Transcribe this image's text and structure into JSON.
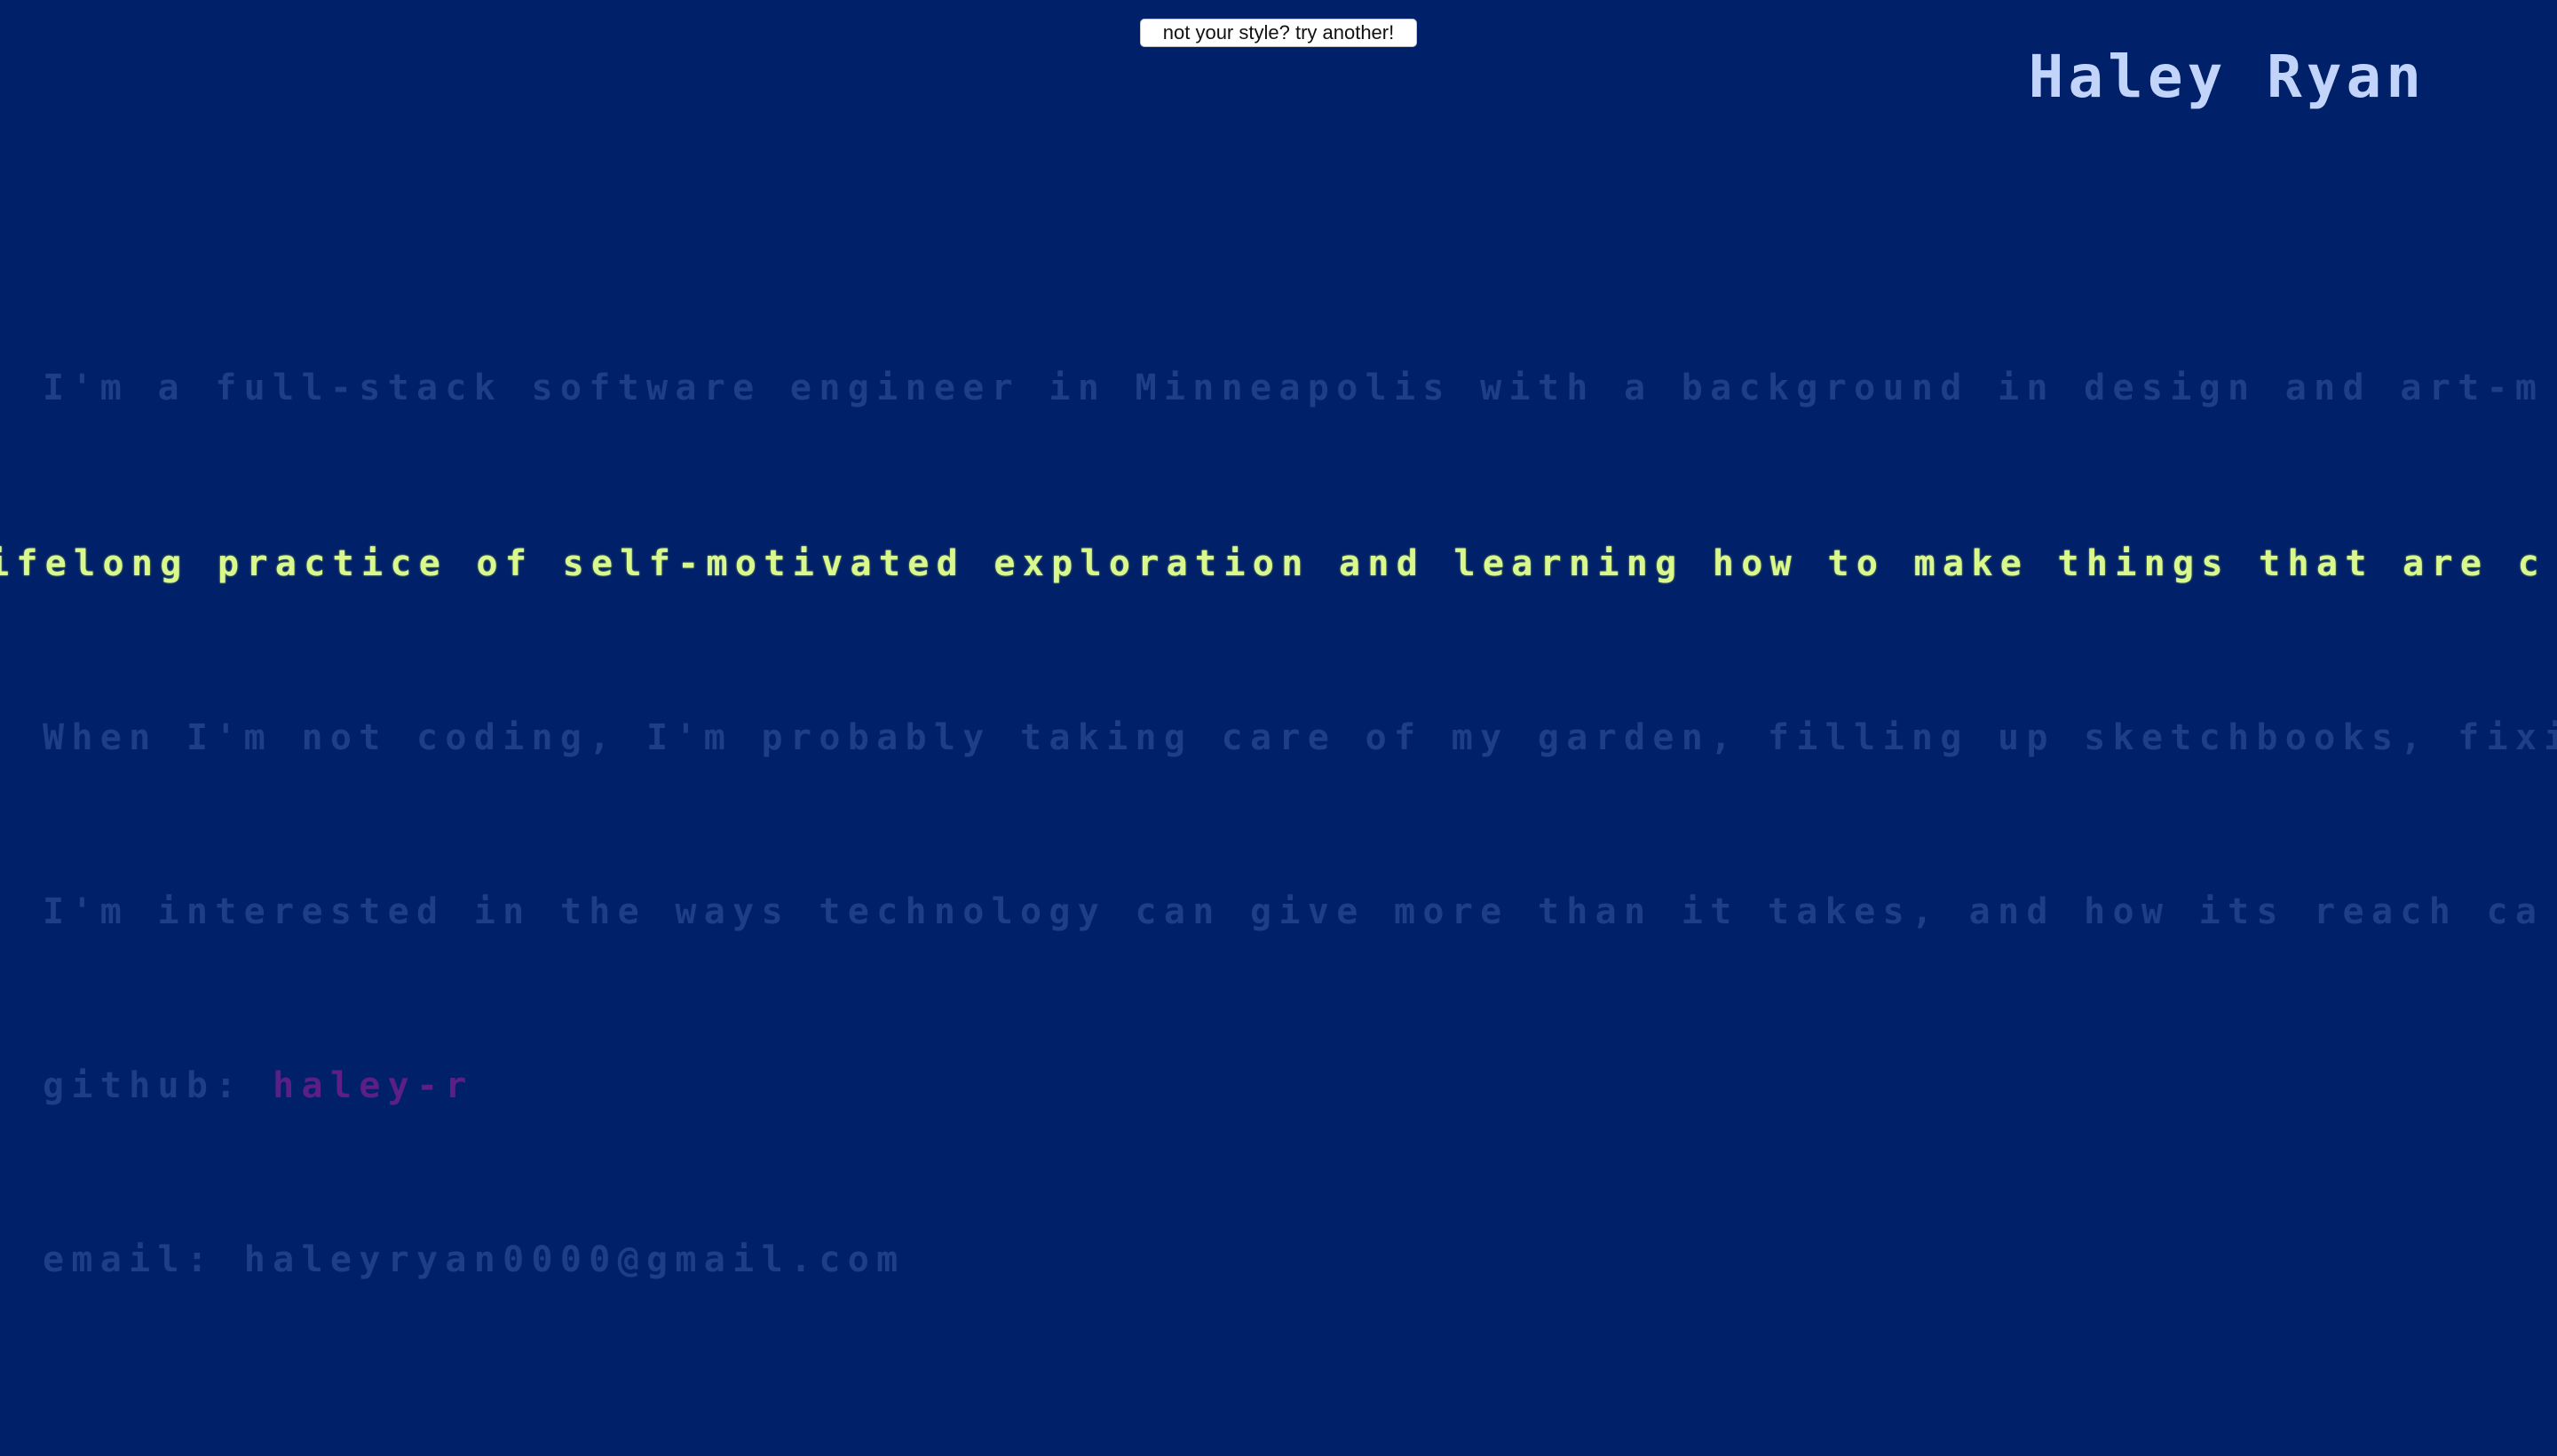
{
  "style_button": {
    "label": "not your style? try another!"
  },
  "header": {
    "name": "Haley Ryan"
  },
  "bio": {
    "line1": "I'm a full-stack software engineer in Minneapolis with a background in design and art-m",
    "line2": "ifelong practice of self-motivated exploration and learning how to make things that are c",
    "line3": "When I'm not coding, I'm probably taking care of my garden, filling up sketchbooks, fixin",
    "line4": "I'm interested in the ways technology can give more than it takes, and how its reach ca"
  },
  "contact": {
    "github_label": "github:",
    "github_handle": "haley-r",
    "email_label": "email:",
    "email_address": "haleyryan0000@gmail.com"
  },
  "colors": {
    "background": "#00216a",
    "highlight_text": "#d9f98f",
    "dim_text": "#1e3e87",
    "name_text": "#c3d4fb",
    "link_text": "#5b1f86"
  }
}
